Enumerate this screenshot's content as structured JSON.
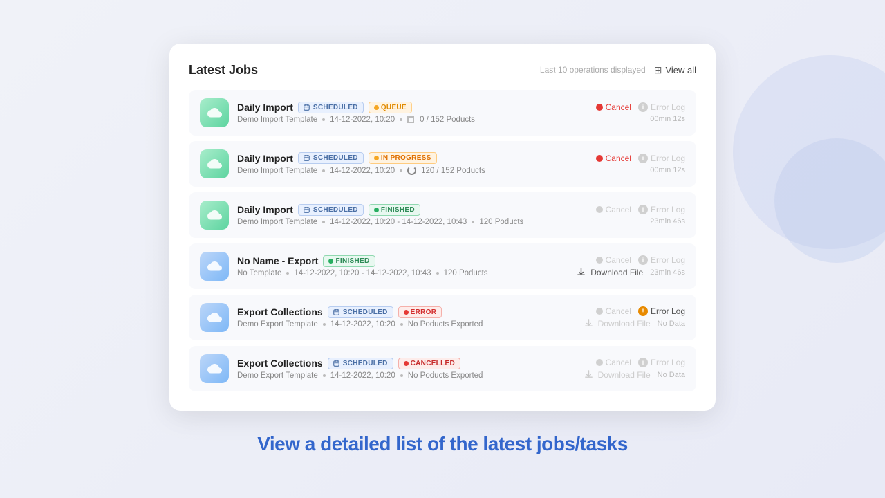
{
  "card": {
    "title": "Latest Jobs",
    "last_ops_text": "Last 10 operations displayed",
    "view_all_label": "View all"
  },
  "jobs": [
    {
      "id": "job-1",
      "name": "Daily Import",
      "icon_type": "green",
      "icon_emoji": "☁️",
      "badges": [
        "SCHEDULED",
        "QUEUE"
      ],
      "template": "Demo Import Template",
      "date": "14-12-2022, 10:20",
      "progress": "0 / 152 Poducts",
      "show_progress_spinner": false,
      "show_progress_circle": true,
      "cancel_active": true,
      "error_log_active": false,
      "download_active": false,
      "download_label": "",
      "no_data": false,
      "time": "00min 12s",
      "date_range": ""
    },
    {
      "id": "job-2",
      "name": "Daily Import",
      "icon_type": "green",
      "icon_emoji": "☁️",
      "badges": [
        "SCHEDULED",
        "IN PROGRESS"
      ],
      "template": "Demo Import Template",
      "date": "14-12-2022, 10:20",
      "progress": "120 / 152 Poducts",
      "show_progress_spinner": true,
      "show_progress_circle": false,
      "cancel_active": true,
      "error_log_active": false,
      "download_active": false,
      "download_label": "",
      "no_data": false,
      "time": "00min 12s",
      "date_range": ""
    },
    {
      "id": "job-3",
      "name": "Daily Import",
      "icon_type": "green",
      "icon_emoji": "☁️",
      "badges": [
        "SCHEDULED",
        "FINISHED"
      ],
      "template": "Demo Import Template",
      "date": "14-12-2022, 10:20 - 14-12-2022, 10:43",
      "progress": "120 Poducts",
      "show_progress_spinner": false,
      "show_progress_circle": false,
      "cancel_active": false,
      "error_log_active": false,
      "download_active": false,
      "download_label": "",
      "no_data": false,
      "time": "23min 46s",
      "date_range": ""
    },
    {
      "id": "job-4",
      "name": "No Name - Export",
      "icon_type": "blue",
      "icon_emoji": "☁️",
      "badges": [
        "FINISHED"
      ],
      "template": "No Template",
      "date": "14-12-2022, 10:20 - 14-12-2022, 10:43",
      "progress": "120 Poducts",
      "show_progress_spinner": false,
      "show_progress_circle": false,
      "cancel_active": false,
      "error_log_active": false,
      "download_active": true,
      "download_label": "Download File",
      "no_data": false,
      "time": "23min 46s",
      "date_range": ""
    },
    {
      "id": "job-5",
      "name": "Export Collections",
      "icon_type": "blue",
      "icon_emoji": "☁️",
      "badges": [
        "SCHEDULED",
        "ERROR"
      ],
      "template": "Demo Export Template",
      "date": "14-12-2022, 10:20",
      "progress": "No Poducts Exported",
      "show_progress_spinner": false,
      "show_progress_circle": false,
      "cancel_active": false,
      "error_log_active": true,
      "download_active": false,
      "download_label": "Download File",
      "no_data": true,
      "time": "",
      "date_range": ""
    },
    {
      "id": "job-6",
      "name": "Export Collections",
      "icon_type": "blue",
      "icon_emoji": "☁️",
      "badges": [
        "SCHEDULED",
        "CANCELLED"
      ],
      "template": "Demo Export Template",
      "date": "14-12-2022, 10:20",
      "progress": "No Poducts Exported",
      "show_progress_spinner": false,
      "show_progress_circle": false,
      "cancel_active": false,
      "error_log_active": false,
      "download_active": false,
      "download_label": "Download File",
      "no_data": true,
      "time": "",
      "date_range": ""
    }
  ],
  "bottom_text": "View a detailed list of the latest jobs/tasks",
  "labels": {
    "cancel": "Cancel",
    "error_log": "Error Log",
    "download_file": "Download File",
    "no_data": "No Data"
  }
}
